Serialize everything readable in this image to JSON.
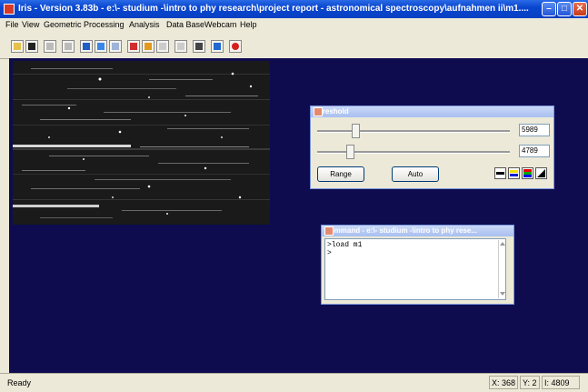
{
  "window": {
    "title": "Iris - Version 3.83b - e:\\- studium -\\intro to phy research\\project report - astronomical spectroscopy\\aufnahmen ii\\m1....",
    "controls": {
      "minimize": "–",
      "maximize": "□",
      "close": "✕"
    }
  },
  "menu": [
    "File",
    "View",
    "Geometric",
    "Processing",
    "Analysis",
    "Data Base",
    "Webcam",
    "Help"
  ],
  "toolbar": {
    "icons": [
      "open-icon",
      "save-icon",
      "undo-icon",
      "compare-icon",
      "grid-icon",
      "crosshair-icon",
      "stack-icon",
      "spectrum-icon",
      "palette-icon",
      "pause-icon",
      "list-icon",
      "camera-icon",
      "star-icon",
      "record-icon"
    ]
  },
  "threshold": {
    "title": "Threshold",
    "high_value": "5989",
    "low_value": "4789",
    "high_level": 0.2,
    "low_level": 0.17,
    "range_label": "Range",
    "auto_label": "Auto",
    "palettes": [
      "black-palette-icon",
      "blue-palette-icon",
      "rgb-palette-icon",
      "gradient-palette-icon"
    ]
  },
  "command": {
    "title": "Command - e:\\- studium -\\intro to phy rese...",
    "lines": [
      ">load m1",
      ">"
    ]
  },
  "status": {
    "text": "Ready",
    "x": "X: 368",
    "y": "Y: 2",
    "intensity": "I: 4809"
  },
  "colors": {
    "workspace": "#0e0c4e",
    "titlebar": "#0a46d0"
  }
}
